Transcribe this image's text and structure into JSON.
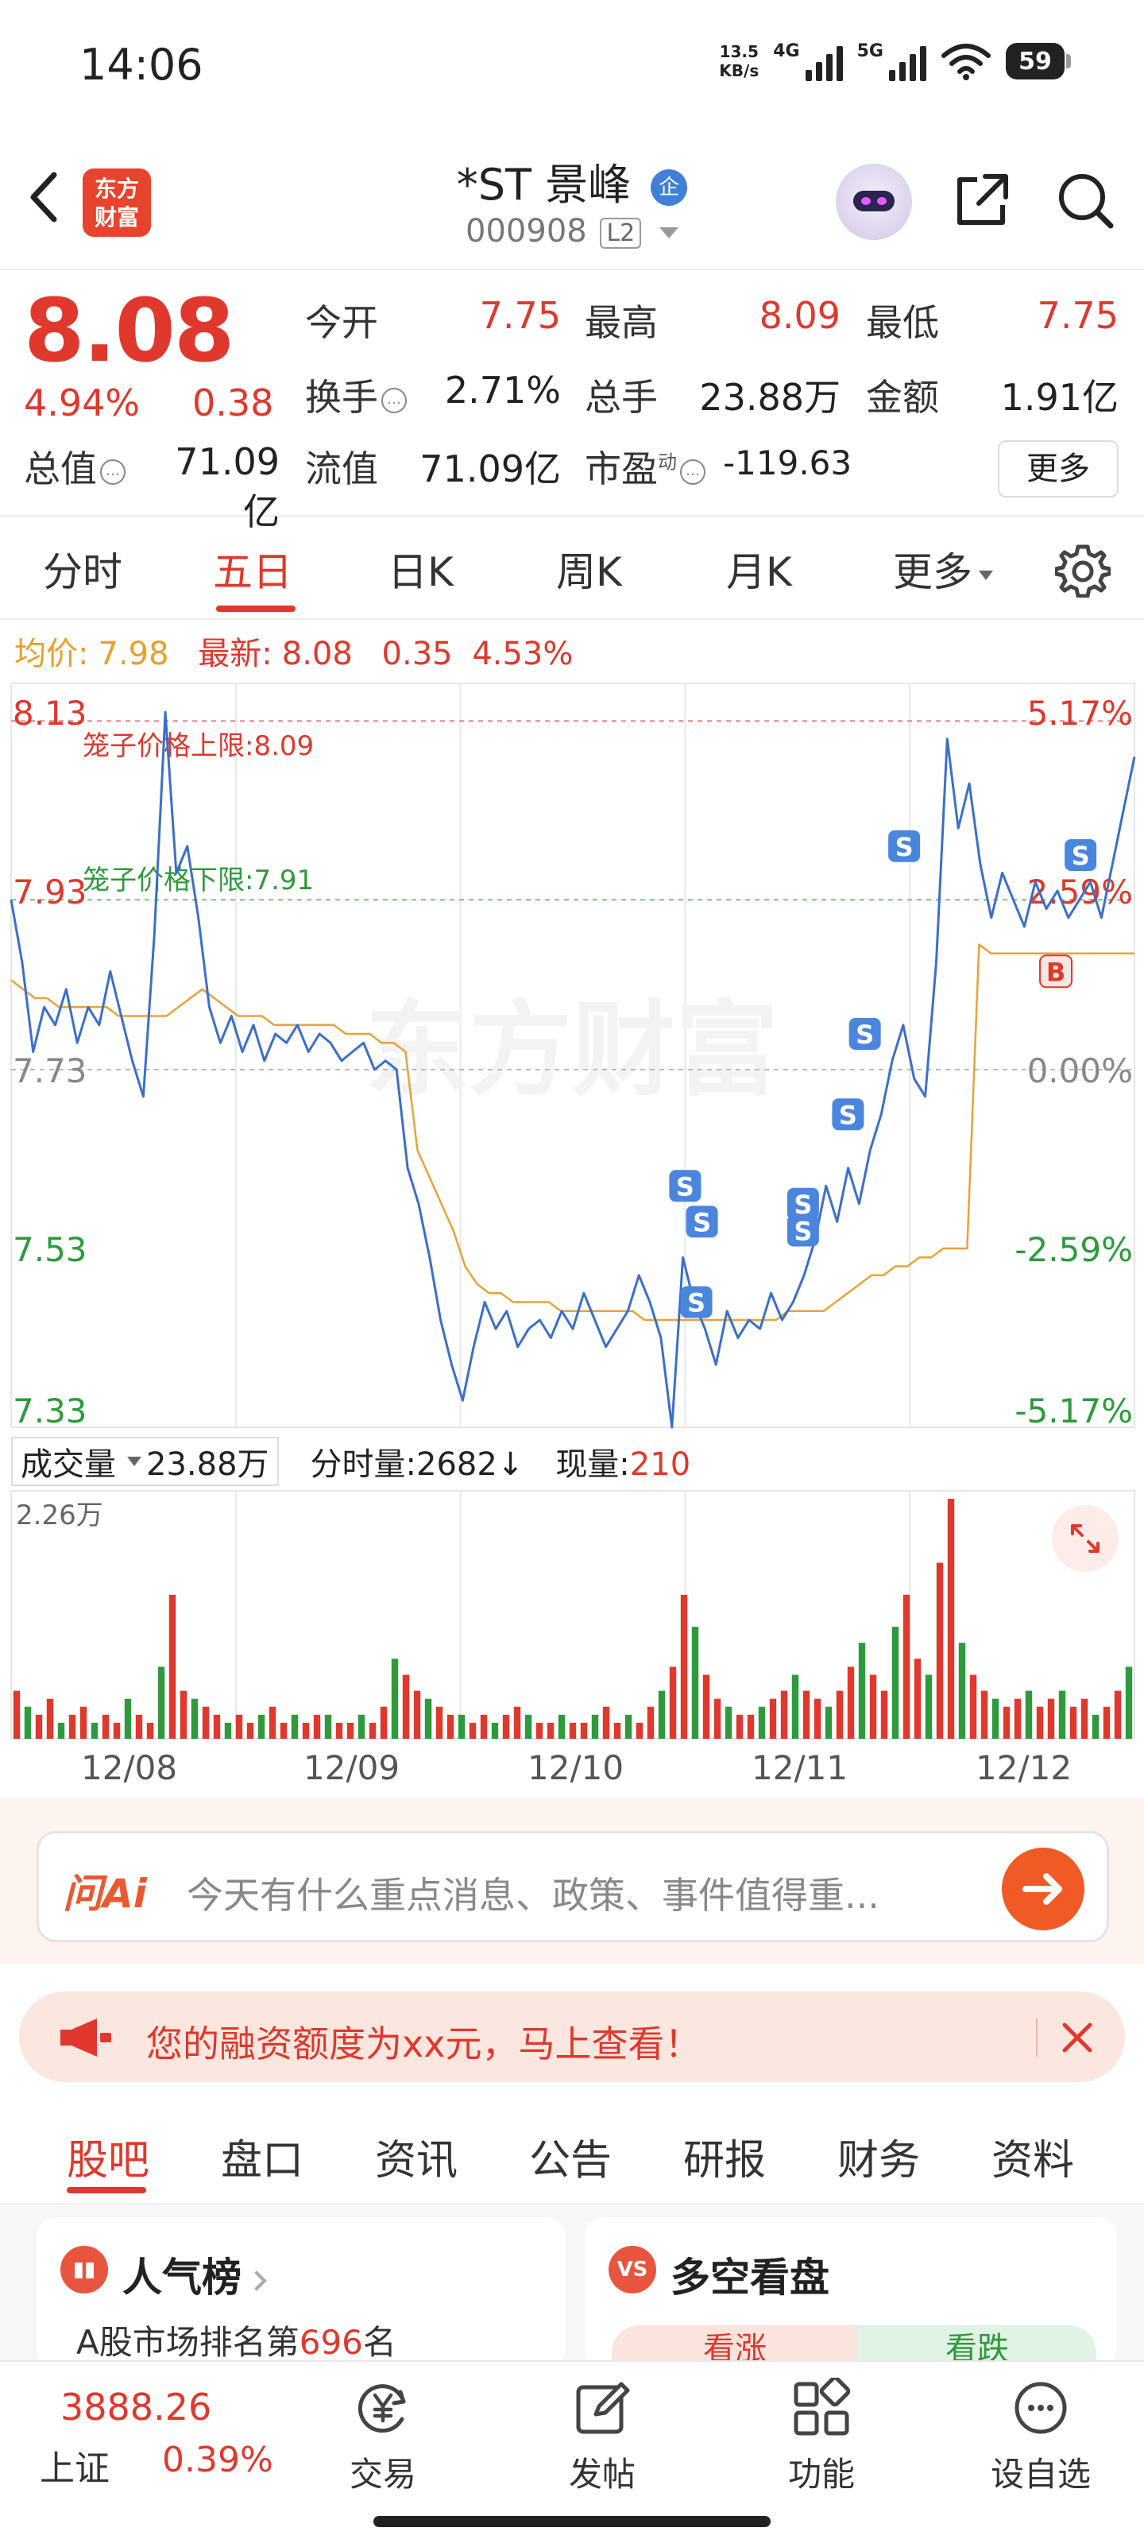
{
  "status_bar": {
    "time": "14:06",
    "net_speed_value": "13.5",
    "net_speed_unit": "KB/s",
    "sig1": "4G",
    "sig2": "5G",
    "battery": "59"
  },
  "header": {
    "logo_line1": "东方",
    "logo_line2": "财富",
    "stock_name": "*ST 景峰",
    "qi_badge": "企",
    "stock_code": "000908",
    "level_badge": "L2"
  },
  "quote": {
    "price": "8.08",
    "change_pct": "4.94%",
    "change_amt": "0.38",
    "open_label": "今开",
    "open_value": "7.75",
    "high_label": "最高",
    "high_value": "8.09",
    "low_label": "最低",
    "low_value": "7.75",
    "turnover_label": "换手",
    "turnover_value": "2.71%",
    "volume_label": "总手",
    "volume_value": "23.88万",
    "amount_label": "金额",
    "amount_value": "1.91亿",
    "mktcap_label": "总值",
    "mktcap_value": "71.09亿",
    "float_label": "流值",
    "float_value": "71.09亿",
    "pe_label": "市盈",
    "pe_sup": "动",
    "pe_value": "-119.63",
    "more_button": "更多"
  },
  "chart_tabs": [
    "分时",
    "五日",
    "日K",
    "周K",
    "月K",
    "更多"
  ],
  "legend": {
    "avg_label": "均价:",
    "avg_value": "7.98",
    "latest_label": "最新:",
    "latest_value": "8.08",
    "latest_change": "0.35",
    "latest_pct": "4.53%"
  },
  "chart_data": {
    "type": "line",
    "title": "",
    "x": [
      "12/08",
      "12/09",
      "12/10",
      "12/11",
      "12/12"
    ],
    "ylim": [
      7.33,
      8.13
    ],
    "y_ticks_left": [
      "8.13",
      "7.93",
      "7.73",
      "7.53",
      "7.33"
    ],
    "y_ticks_right": [
      "5.17%",
      "2.59%",
      "0.00%",
      "-2.59%",
      "-5.17%"
    ],
    "upper_limit_label": "笼子价格上限:8.09",
    "lower_limit_label": "笼子价格下限:7.91",
    "watermark": "东方财富",
    "series": [
      {
        "values": [
          7.92,
          7.85,
          7.75,
          7.8,
          7.78,
          7.82,
          7.76,
          7.8,
          7.78,
          7.84,
          7.79,
          7.74,
          7.7,
          7.88,
          8.13,
          7.95,
          7.98,
          7.9,
          7.8,
          7.76,
          7.79,
          7.75,
          7.78,
          7.74,
          7.77,
          7.76,
          7.78,
          7.75,
          7.77,
          7.76,
          7.74,
          7.75,
          7.76,
          7.73,
          7.74,
          7.73,
          7.62,
          7.58,
          7.52,
          7.45,
          7.4,
          7.36,
          7.42,
          7.47,
          7.44,
          7.46,
          7.42,
          7.44,
          7.45,
          7.43,
          7.46,
          7.44,
          7.48,
          7.45,
          7.42,
          7.44,
          7.46,
          7.5,
          7.47,
          7.43,
          7.33,
          7.52,
          7.47,
          7.44,
          7.4,
          7.46,
          7.43,
          7.45,
          7.44,
          7.48,
          7.45,
          7.47,
          7.5,
          7.54,
          7.6,
          7.56,
          7.62,
          7.58,
          7.64,
          7.68,
          7.74,
          7.78,
          7.72,
          7.7,
          7.85,
          8.1,
          8.0,
          8.05,
          7.96,
          7.9,
          7.95,
          7.92,
          7.89,
          7.94,
          7.91,
          7.93,
          7.9,
          7.92,
          7.94,
          7.9,
          7.96,
          8.02,
          8.08
        ]
      },
      {
        "values": [
          7.83,
          7.82,
          7.81,
          7.81,
          7.8,
          7.8,
          7.8,
          7.8,
          7.8,
          7.79,
          7.79,
          7.79,
          7.79,
          7.79,
          7.8,
          7.81,
          7.82,
          7.81,
          7.8,
          7.79,
          7.79,
          7.79,
          7.78,
          7.78,
          7.78,
          7.78,
          7.78,
          7.78,
          7.77,
          7.77,
          7.77,
          7.76,
          7.76,
          7.75,
          7.64,
          7.61,
          7.58,
          7.55,
          7.51,
          7.49,
          7.48,
          7.48,
          7.47,
          7.47,
          7.47,
          7.47,
          7.46,
          7.46,
          7.46,
          7.46,
          7.46,
          7.46,
          7.46,
          7.45,
          7.45,
          7.45,
          7.45,
          7.45,
          7.45,
          7.45,
          7.45,
          7.45,
          7.45,
          7.45,
          7.45,
          7.46,
          7.46,
          7.46,
          7.46,
          7.47,
          7.48,
          7.49,
          7.5,
          7.5,
          7.51,
          7.51,
          7.52,
          7.52,
          7.53,
          7.53,
          7.53,
          7.87,
          7.86,
          7.86,
          7.86,
          7.86,
          7.86,
          7.86,
          7.86,
          7.86,
          7.86,
          7.86,
          7.86,
          7.86,
          7.86
        ]
      }
    ],
    "volume": {
      "max_label": "2.26万",
      "values": [
        6,
        4,
        3,
        5,
        2,
        3,
        4,
        2,
        3,
        2,
        5,
        3,
        2,
        9,
        18,
        6,
        5,
        4,
        3,
        2,
        3,
        2,
        3,
        4,
        2,
        3,
        2,
        3,
        3,
        2,
        2,
        3,
        2,
        4,
        10,
        8,
        6,
        5,
        4,
        3,
        3,
        2,
        3,
        2,
        3,
        4,
        3,
        2,
        2,
        3,
        2,
        2,
        3,
        4,
        2,
        3,
        2,
        4,
        6,
        9,
        18,
        14,
        8,
        5,
        4,
        3,
        3,
        4,
        5,
        6,
        8,
        6,
        5,
        4,
        6,
        9,
        12,
        8,
        6,
        14,
        18,
        10,
        8,
        22,
        30,
        12,
        8,
        6,
        5,
        4,
        5,
        6,
        4,
        5,
        6,
        4,
        5,
        3,
        4,
        6,
        9
      ]
    },
    "markers": [
      {
        "label": "S"
      },
      {
        "label": "S"
      },
      {
        "label": "S"
      },
      {
        "label": "S"
      },
      {
        "label": "S"
      },
      {
        "label": "S"
      },
      {
        "label": "S"
      },
      {
        "label": "S"
      },
      {
        "label": "S"
      },
      {
        "label": "B"
      }
    ]
  },
  "vol_header": {
    "select_label": "成交量",
    "total": "23.88万",
    "period_label": "分时量:",
    "period_value": "2682↓",
    "now_label": "现量:",
    "now_value": "210"
  },
  "dates": [
    "12/08",
    "12/09",
    "12/10",
    "12/11",
    "12/12"
  ],
  "ai": {
    "logo": "问Ai",
    "placeholder": "今天有什么重点消息、政策、事件值得重..."
  },
  "banner": {
    "text": "您的融资额度为xx元，马上查看！"
  },
  "bottom_tabs": [
    "股吧",
    "盘口",
    "资讯",
    "公告",
    "研报",
    "财务",
    "资料"
  ],
  "cards": {
    "popularity_title": "人气榜",
    "popularity_rank_prefix": "A股市场排名第",
    "popularity_rank": "696",
    "popularity_rank_suffix": "名",
    "vs_icon": "VS",
    "vs_title": "多空看盘",
    "bull_label": "看涨",
    "bear_label": "看跌"
  },
  "bottom_nav": {
    "index_value": "3888.26",
    "index_name": "上证",
    "index_pct": "0.39%",
    "items": [
      "交易",
      "发帖",
      "功能",
      "设自选"
    ]
  }
}
